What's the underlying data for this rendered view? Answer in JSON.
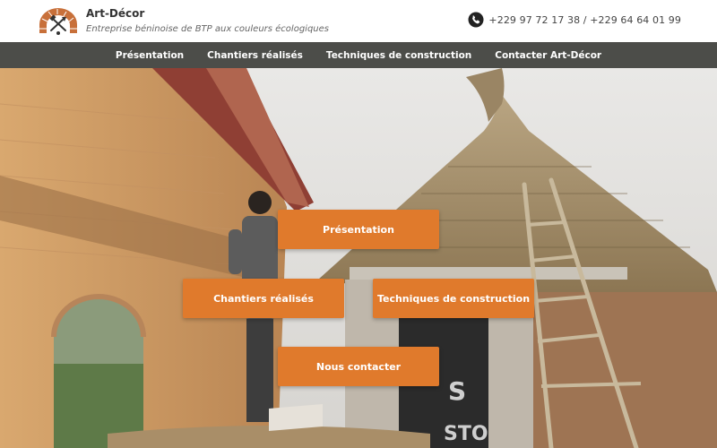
{
  "header": {
    "brand_name": "Art-Décor",
    "tagline": "Entreprise béninoise de BTP aux couleurs écologiques",
    "phone": "+229 97 72 17 38 / +229 64 64 01 99",
    "logo_icon": "brick-arch-tools-logo",
    "phone_icon": "phone-icon"
  },
  "nav": {
    "items": [
      {
        "label": "Présentation"
      },
      {
        "label": "Chantiers réalisés"
      },
      {
        "label": "Techniques de construction"
      },
      {
        "label": "Contacter Art-Décor"
      }
    ]
  },
  "hero": {
    "buttons": {
      "presentation": "Présentation",
      "chantiers": "Chantiers réalisés",
      "techniques": "Techniques de construction",
      "contact": "Nous contacter"
    }
  },
  "colors": {
    "accent": "#e07a2c",
    "nav_bg": "#4c4d49",
    "header_bg": "#ffffff"
  }
}
